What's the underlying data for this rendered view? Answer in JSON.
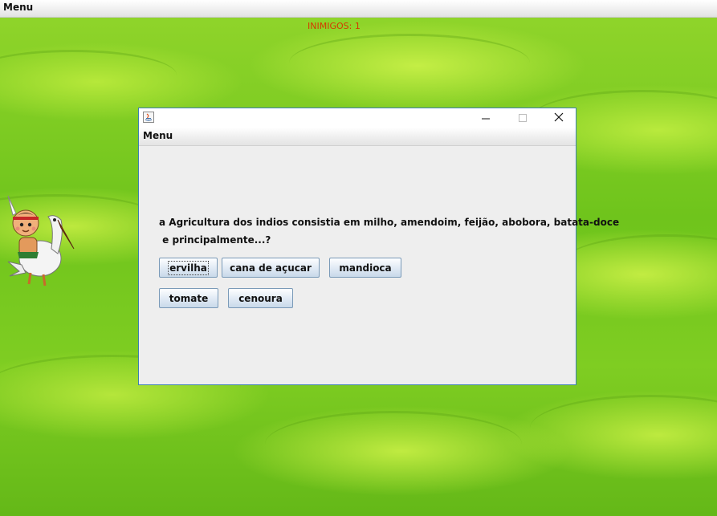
{
  "menubar": {
    "menu_label": "Menu"
  },
  "hud": {
    "enemies_label": "INIMIGOS: 1"
  },
  "dialog": {
    "menu_label": "Menu",
    "question_line1": "a Agricultura dos indios consistia em milho, amendoim, feijão, abobora, batata-doce",
    "question_line2": " e principalmente...?",
    "answers": [
      {
        "label": "ervilha"
      },
      {
        "label": "cana de açucar"
      },
      {
        "label": "mandioca"
      },
      {
        "label": "tomate"
      },
      {
        "label": "cenoura"
      }
    ]
  },
  "colors": {
    "grass": "#7ed321",
    "enemy_counter": "#d33a00",
    "dialog_border": "#3c7fb1"
  },
  "icons": [
    "java-app-icon",
    "minimize-icon",
    "maximize-icon",
    "close-icon"
  ]
}
